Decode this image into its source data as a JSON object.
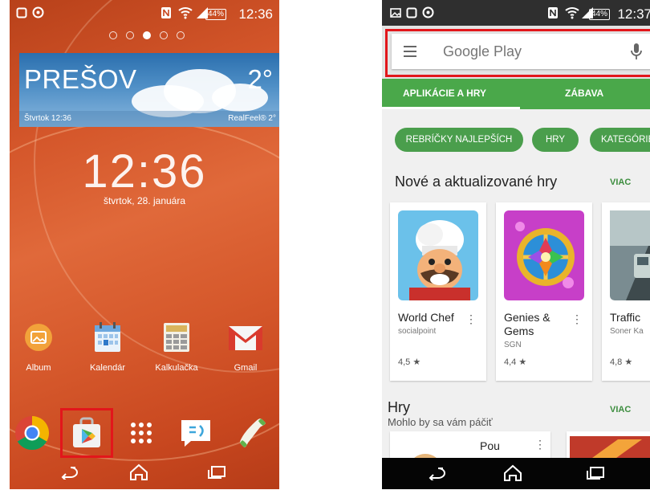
{
  "left_phone": {
    "status_bar": {
      "time": "12:36",
      "battery": "44%"
    },
    "page_indicator": {
      "count": 5,
      "active_index": 2
    },
    "weather_widget": {
      "city": "PREŠOV",
      "temperature": "2°",
      "day_time": "Štvrtok 12:36",
      "realfeel": "RealFeel® 2°"
    },
    "clock": {
      "time": "12:36",
      "date": "štvrtok, 28. januára"
    },
    "apps": [
      {
        "label": "Album",
        "icon": "album-icon"
      },
      {
        "label": "Kalendár",
        "icon": "calendar-icon"
      },
      {
        "label": "Kalkulačka",
        "icon": "calculator-icon"
      },
      {
        "label": "Gmail",
        "icon": "gmail-icon"
      }
    ],
    "dock": [
      "chrome-icon",
      "play-store-icon",
      "app-drawer-icon",
      "messaging-icon",
      "phone-icon"
    ],
    "highlight": "play-store-icon",
    "nav": [
      "back-icon",
      "home-icon",
      "recents-icon"
    ],
    "colors": {
      "highlight_box": "#e2161b"
    }
  },
  "right_phone": {
    "status_bar": {
      "time": "12:37",
      "battery": "44%"
    },
    "search": {
      "placeholder": "Google Play",
      "menu_icon": "hamburger-icon",
      "voice_icon": "microphone-icon"
    },
    "tabs": [
      {
        "label": "APLIKÁCIE A HRY",
        "active": true
      },
      {
        "label": "ZÁBAVA",
        "active": false
      }
    ],
    "chips": [
      "REBRÍČKY NAJLEPŠÍCH",
      "HRY",
      "KATEGÓRIE"
    ],
    "section1": {
      "title": "Nové a aktualizované hry",
      "more": "VIAC",
      "cards": [
        {
          "name": "World Chef",
          "developer": "socialpoint",
          "rating": "4,5 ★"
        },
        {
          "name": "Genies & Gems",
          "developer": "SGN",
          "rating": "4,4 ★"
        },
        {
          "name": "Traffic",
          "developer": "Soner Ka",
          "rating": "4,8 ★"
        }
      ]
    },
    "section2": {
      "title": "Hry",
      "subtitle": "Mohlo by sa vám páčiť",
      "more": "VIAC",
      "first_app": "Pou"
    },
    "nav": [
      "back-icon",
      "home-icon",
      "recents-icon"
    ],
    "colors": {
      "accent": "#4aa84a",
      "highlight_box": "#e2161b"
    }
  }
}
